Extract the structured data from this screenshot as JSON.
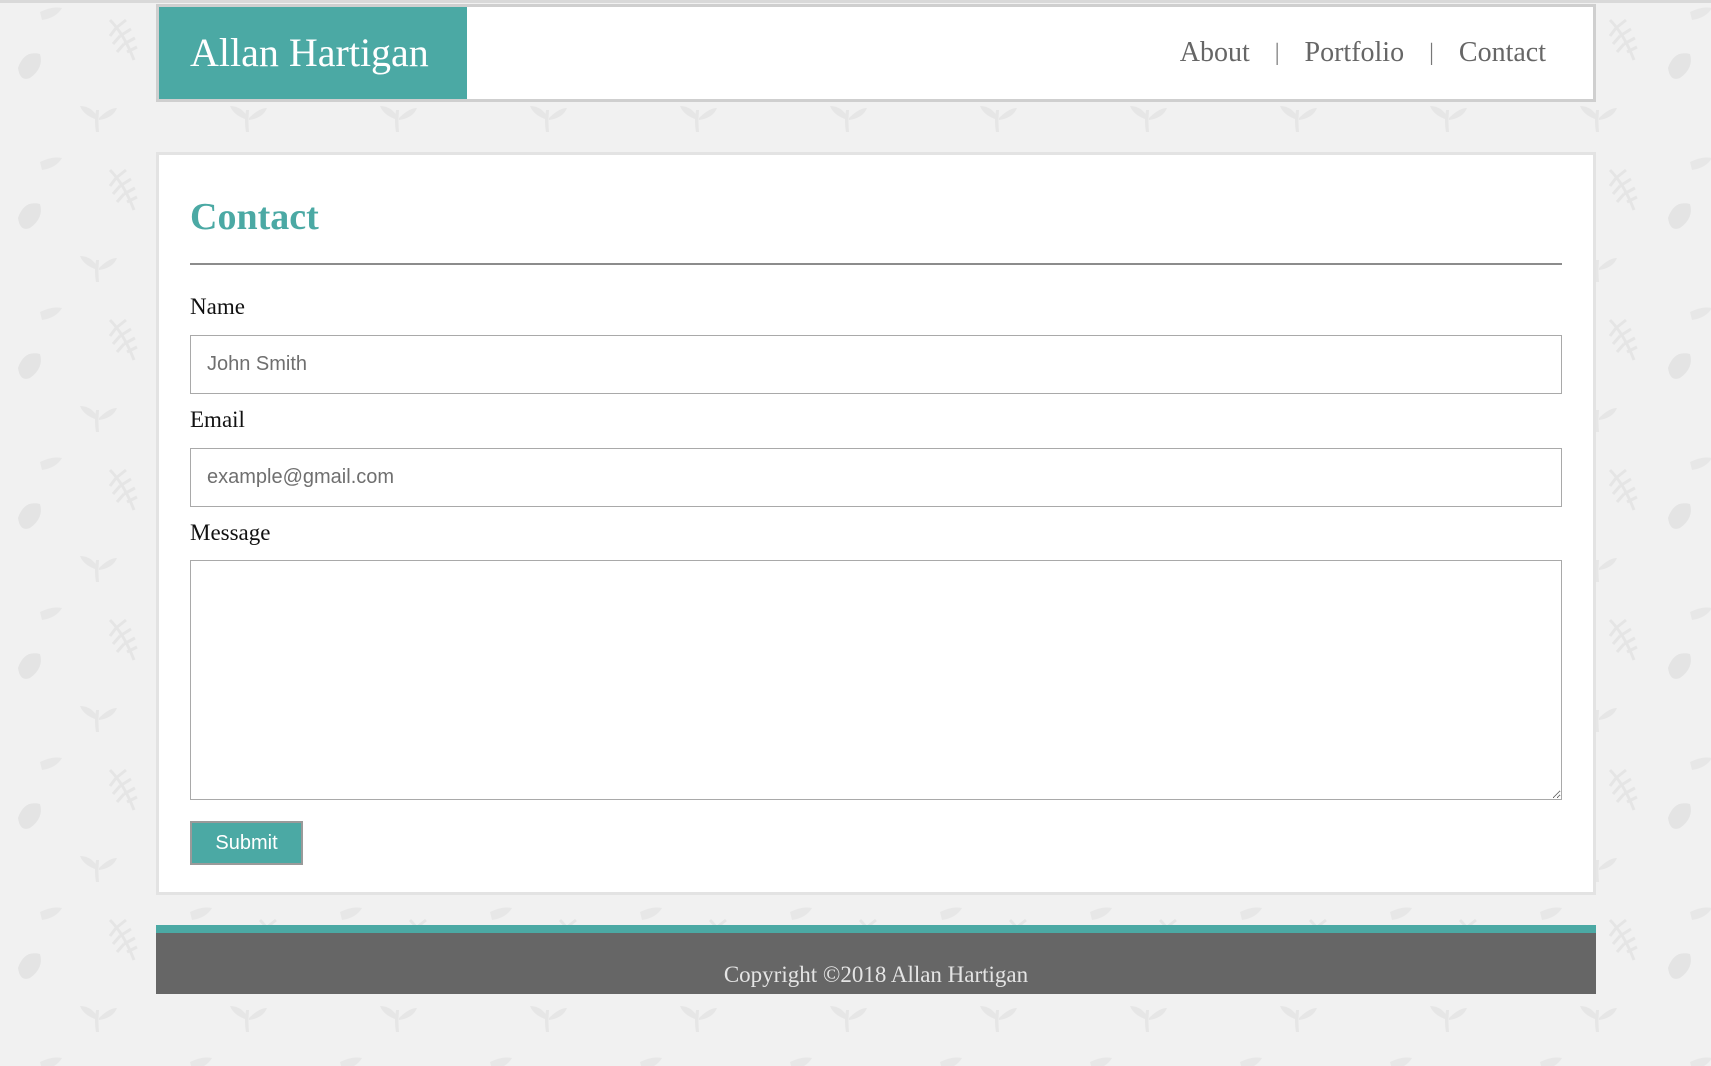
{
  "site": {
    "brand": "Allan Hartigan"
  },
  "nav": {
    "items": [
      {
        "label": "About"
      },
      {
        "label": "Portfolio"
      },
      {
        "label": "Contact"
      }
    ],
    "separator": "|"
  },
  "main": {
    "title": "Contact",
    "form": {
      "name_label": "Name",
      "name_placeholder": "John Smith",
      "email_label": "Email",
      "email_placeholder": "example@gmail.com",
      "message_label": "Message",
      "submit_label": "Submit"
    }
  },
  "footer": {
    "copyright": "Copyright ©2018 Allan Hartigan"
  },
  "colors": {
    "accent": "#4ba9a4",
    "footer_bg": "#666666",
    "page_bg": "#f1f1f1",
    "nav_text": "#666666"
  }
}
